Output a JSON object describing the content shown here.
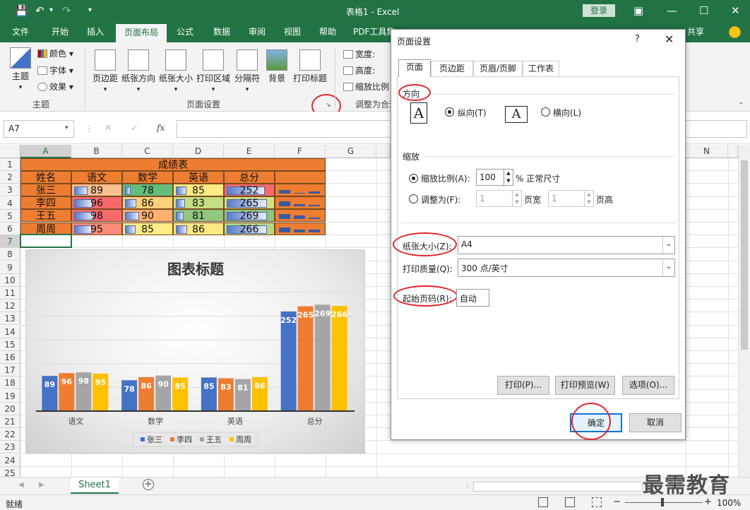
{
  "window": {
    "title": "表格1 - Excel",
    "login": "登录"
  },
  "ribbon_tabs": [
    "文件",
    "开始",
    "插入",
    "页面布局",
    "公式",
    "数据",
    "审阅",
    "视图",
    "帮助",
    "PDF工具集"
  ],
  "share": "共享",
  "ribbon": {
    "theme": {
      "label": "主题",
      "colors": "颜色",
      "fonts": "字体",
      "effects": "效果",
      "group": "主题"
    },
    "page_setup": {
      "margins": "页边距",
      "orientation": "纸张方向",
      "size": "纸张大小",
      "print_area": "打印区域",
      "breaks": "分隔符",
      "background": "背景",
      "print_titles": "打印标题",
      "group": "页面设置"
    },
    "scale": {
      "width": "宽度:",
      "height": "高度:",
      "scale": "缩放比例",
      "group": "调整为合适"
    }
  },
  "namebox": "A7",
  "columns": [
    "A",
    "B",
    "C",
    "D",
    "E",
    "F",
    "G",
    "N"
  ],
  "rows": [
    "1",
    "2",
    "3",
    "4",
    "5",
    "6",
    "7",
    "8",
    "9",
    "10",
    "11",
    "12",
    "13",
    "14",
    "15",
    "16",
    "17",
    "18",
    "19",
    "20",
    "21",
    "22",
    "23",
    "24",
    "25"
  ],
  "sheet": {
    "title": "成绩表",
    "headers": [
      "姓名",
      "语文",
      "数学",
      "英语",
      "总分"
    ],
    "data": [
      {
        "name": "张三",
        "yw": "89",
        "sx": "78",
        "yy": "85",
        "zf": "252"
      },
      {
        "name": "李四",
        "yw": "96",
        "sx": "86",
        "yy": "83",
        "zf": "265"
      },
      {
        "name": "王五",
        "yw": "98",
        "sx": "90",
        "yy": "81",
        "zf": "269"
      },
      {
        "name": "周周",
        "yw": "95",
        "sx": "85",
        "yy": "86",
        "zf": "266"
      }
    ]
  },
  "chart_data": {
    "type": "bar",
    "title": "图表标题",
    "categories": [
      "语文",
      "数学",
      "英语",
      "总分"
    ],
    "series": [
      {
        "name": "张三",
        "values": [
          89,
          78,
          85,
          252
        ],
        "color": "#4472c4"
      },
      {
        "name": "李四",
        "values": [
          96,
          86,
          83,
          265
        ],
        "color": "#ed7d31"
      },
      {
        "name": "王五",
        "values": [
          98,
          90,
          81,
          269
        ],
        "color": "#a5a5a5"
      },
      {
        "name": "周周",
        "values": [
          95,
          85,
          86,
          266
        ],
        "color": "#ffc000"
      }
    ],
    "ylim": [
      0,
      300
    ],
    "legend": "bottom",
    "grid": true
  },
  "dialog": {
    "title": "页面设置",
    "help": "?",
    "tabs": [
      "页面",
      "页边距",
      "页眉/页脚",
      "工作表"
    ],
    "orientation_label": "方向",
    "portrait": "纵向(T)",
    "landscape": "横向(L)",
    "scaling_label": "缩放",
    "scale_label": "缩放比例(A):",
    "scale_value": "100",
    "scale_unit": "% 正常尺寸",
    "fit_label": "调整为(F):",
    "fit_wide": "1",
    "fit_wide_unit": "页宽",
    "fit_tall": "1",
    "fit_tall_unit": "页高",
    "paper_label": "纸张大小(Z):",
    "paper_value": "A4",
    "quality_label": "打印质量(Q):",
    "quality_value": "300 点/英寸",
    "first_page_label": "起始页码(R):",
    "first_page_value": "自动",
    "print_btn": "打印(P)...",
    "preview_btn": "打印预览(W)",
    "options_btn": "选项(O)...",
    "ok": "确定",
    "cancel": "取消"
  },
  "sheet_tab": "Sheet1",
  "status": {
    "ready": "就绪",
    "zoom": "100%"
  },
  "watermark": "最需教育"
}
